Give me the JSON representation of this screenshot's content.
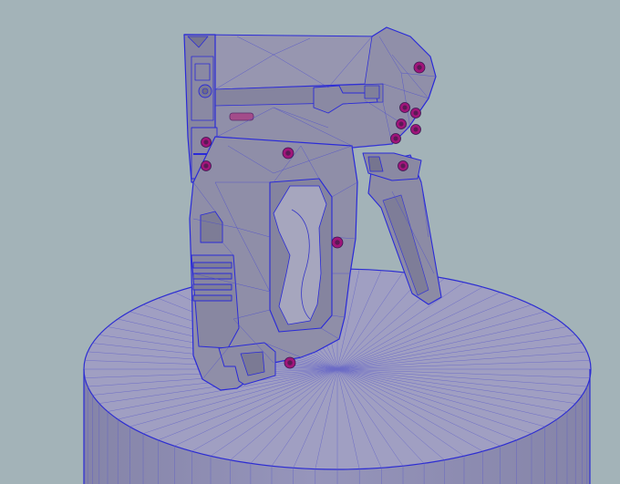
{
  "viewport": {
    "background_color": "#a3b3b8",
    "model_fill": "#8f8ea6",
    "model_fill_light": "#9c9bb4",
    "model_fill_dark": "#7a7991",
    "wire_color": "#2a2ad8",
    "edge_line_color": "#3d3d66",
    "pedestal_top_fill": "#9f9fbf",
    "pedestal_side_fill": "#8e8db0",
    "screw_color": "#a0157a"
  },
  "scene_objects": [
    {
      "name": "pedestal-cylinder"
    },
    {
      "name": "gun-model"
    }
  ]
}
